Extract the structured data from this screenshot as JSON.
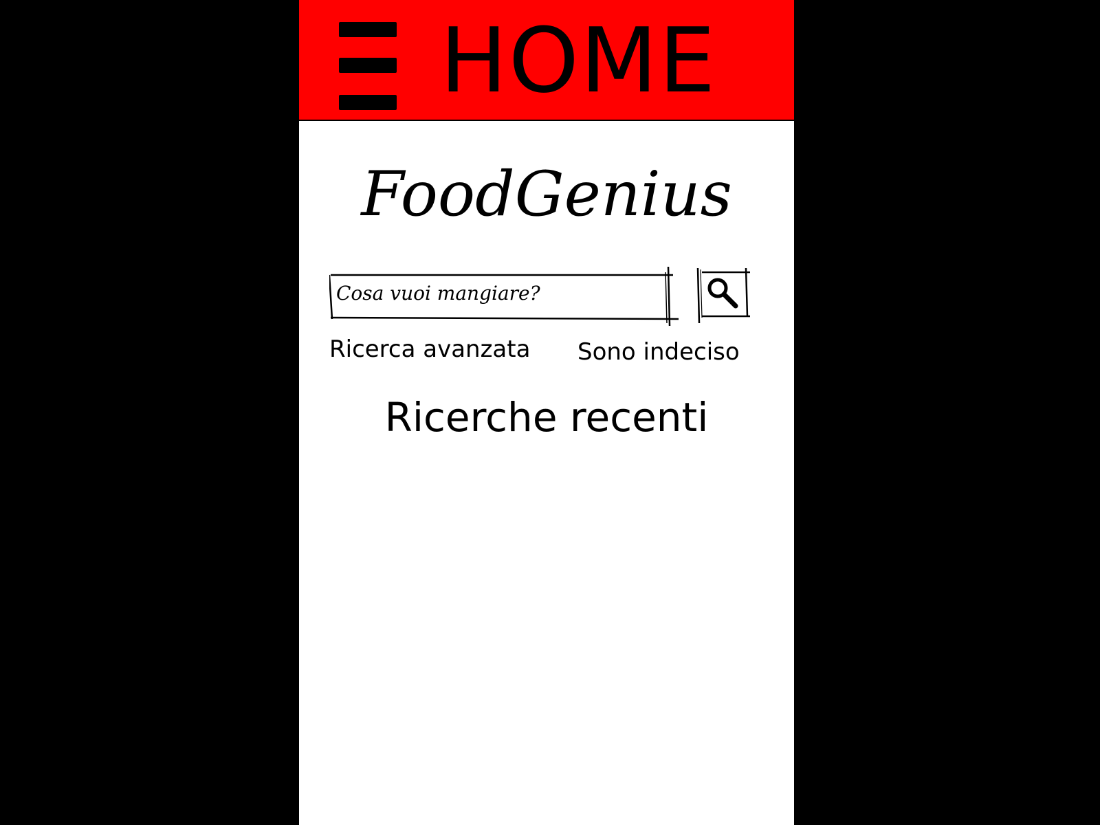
{
  "header": {
    "title": "HOME",
    "menu_icon": "hamburger-menu-icon",
    "background_color": "#ff0000"
  },
  "app": {
    "title": "FoodGenius"
  },
  "search": {
    "placeholder": "Cosa vuoi mangiare?",
    "value": "",
    "button_icon": "search-icon"
  },
  "links": {
    "advanced_search": "Ricerca avanzata",
    "undecided": "Sono indeciso"
  },
  "recent": {
    "title": "Ricerche recenti",
    "items": []
  }
}
